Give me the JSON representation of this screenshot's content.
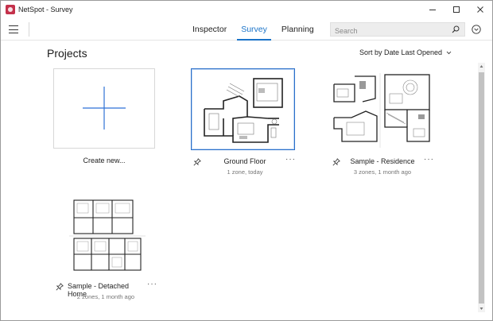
{
  "window": {
    "title": "NetSpot - Survey",
    "controls": [
      "minimize",
      "maximize",
      "close"
    ]
  },
  "toolbar": {
    "menu_icon": "hamburger-icon",
    "tabs": [
      {
        "label": "Inspector",
        "active": false
      },
      {
        "label": "Survey",
        "active": true
      },
      {
        "label": "Planning",
        "active": false
      }
    ],
    "search": {
      "placeholder": "Search",
      "value": ""
    },
    "account_icon": "chevron-circle-icon"
  },
  "main": {
    "title": "Projects",
    "sort_label": "Sort by Date Last Opened",
    "create_label": "Create new...",
    "projects": [
      {
        "name": "Ground Floor",
        "meta": "1 zone, today",
        "selected": true
      },
      {
        "name": "Sample - Residence",
        "meta": "3 zones, 1 month ago",
        "selected": false
      },
      {
        "name": "Sample - Detached Home",
        "meta": "2 zones, 1 month ago",
        "selected": false
      }
    ]
  },
  "colors": {
    "accent": "#1a73c8",
    "create_plus": "#2f72d6",
    "selected_border": "#2b6fc9"
  }
}
